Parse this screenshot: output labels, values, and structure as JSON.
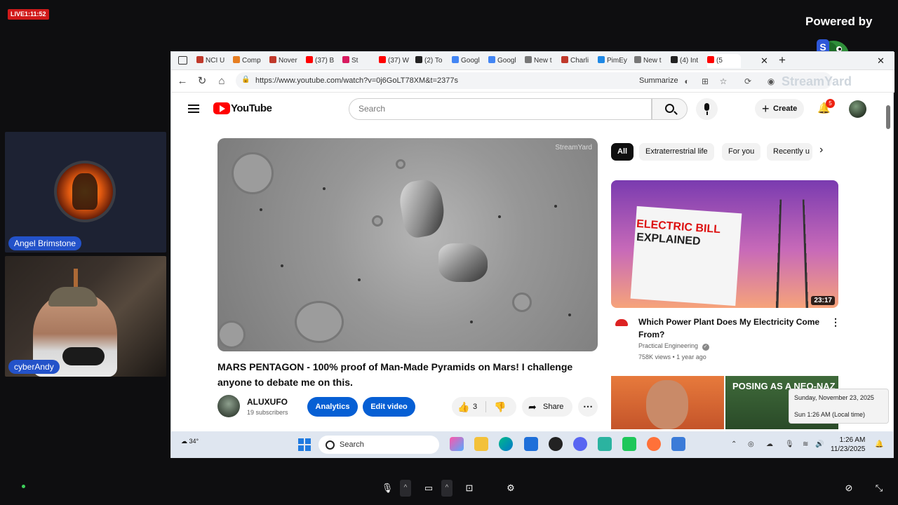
{
  "stream": {
    "live_badge": "LIVE1:11:52",
    "powered_by": "Powered by",
    "watermark": "StreamYard"
  },
  "participants": [
    {
      "name": "Angel Brimstone"
    },
    {
      "name": "cyberAndy"
    }
  ],
  "browser": {
    "tabs": [
      {
        "label": "NCI U",
        "color": "#c0392b"
      },
      {
        "label": "Comp",
        "color": "#e67e22"
      },
      {
        "label": "Nover",
        "color": "#c0392b"
      },
      {
        "label": "(37) B",
        "color": "#ff0000"
      },
      {
        "label": "St",
        "color": "#d81b60"
      },
      {
        "label": "(37) W",
        "color": "#ff0000"
      },
      {
        "label": "(2) To",
        "color": "#222222"
      },
      {
        "label": "Googl",
        "color": "#4285f4"
      },
      {
        "label": "Googl",
        "color": "#4285f4"
      },
      {
        "label": "New t",
        "color": "#777777"
      },
      {
        "label": "Charli",
        "color": "#c0392b"
      },
      {
        "label": "PimEy",
        "color": "#1e88e5"
      },
      {
        "label": "New t",
        "color": "#777777"
      },
      {
        "label": "(4) Int",
        "color": "#222222"
      },
      {
        "label": "(5",
        "color": "#ff0000"
      }
    ],
    "url": "https://www.youtube.com/watch?v=0j6GoLT78XM&t=2377s",
    "summarize": "Summarize"
  },
  "youtube": {
    "logo_text": "YouTube",
    "search_placeholder": "Search",
    "create_label": "Create",
    "notification_count": "5",
    "video": {
      "title": "MARS PENTAGON - 100% proof of Man-Made Pyramids on Mars! I challenge anyone to debate me on this.",
      "channel": "ALUXUFO",
      "subscribers": "19 subscribers",
      "analytics_label": "Analytics",
      "edit_label": "Edit video",
      "likes": "3",
      "share_label": "Share"
    },
    "chips": [
      "All",
      "Extraterrestrial life",
      "For you",
      "Recently u"
    ],
    "recommendation": {
      "thumb_line1": "ELECTRIC BILL",
      "thumb_line2": "EXPLAINED",
      "duration": "23:17",
      "title": "Which Power Plant Does My Electricity Come From?",
      "channel": "Practical Engineering",
      "meta": "758K views • 1 year ago"
    },
    "recommendation2": {
      "thumb_text": "POSING AS A NEO-NAZ"
    }
  },
  "tooltip": {
    "date": "Sunday, November 23, 2025",
    "time": "Sun 1:26 AM (Local time)"
  },
  "taskbar": {
    "weather": "34°",
    "search": "Search",
    "time": "1:26 AM",
    "date": "11/23/2025"
  },
  "colors": {
    "accent_blue": "#065fd4",
    "name_tag": "#2352c9",
    "live_red": "#d11a1a"
  }
}
